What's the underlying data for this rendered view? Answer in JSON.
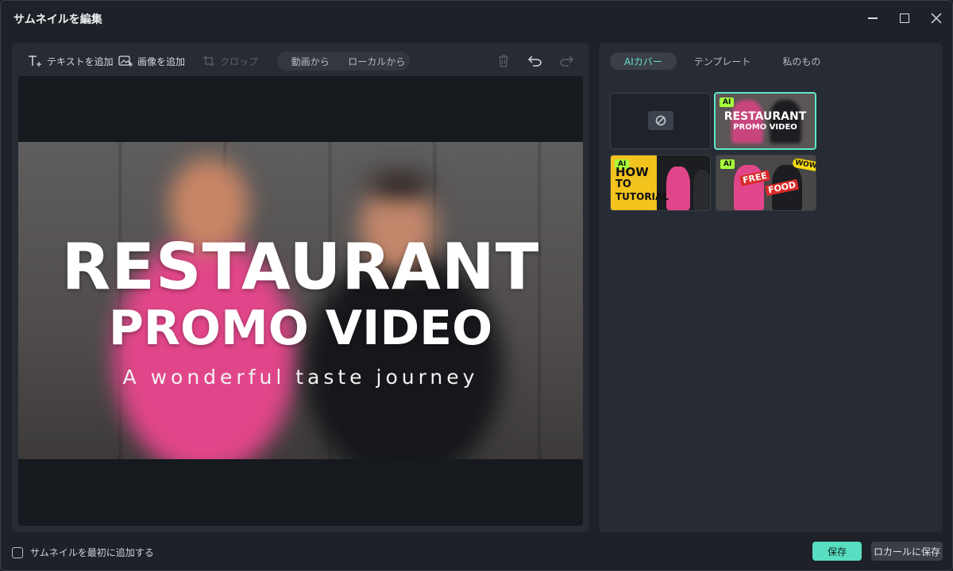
{
  "window": {
    "title": "サムネイルを編集",
    "controls": {
      "minimize": "minimize-icon",
      "maximize": "maximize-icon",
      "close": "close-icon"
    }
  },
  "toolbar": {
    "add_text": "テキストを追加",
    "add_image": "画像を追加",
    "crop": "クロップ",
    "source_segments": [
      "動画から",
      "ローカルから"
    ],
    "icons": [
      "delete-icon",
      "undo-icon",
      "redo-icon"
    ]
  },
  "preview": {
    "title_line1": "RESTAURANT",
    "title_line2": "PROMO VIDEO",
    "subtitle": "A wonderful taste journey"
  },
  "side": {
    "tabs": [
      {
        "label": "AIカバー",
        "active": true
      },
      {
        "label": "テンプレート",
        "active": false
      },
      {
        "label": "私のもの",
        "active": false
      }
    ],
    "thumbnails": [
      {
        "kind": "none",
        "icon": "none-icon"
      },
      {
        "kind": "ai",
        "tag": "AI",
        "line1": "RESTAURANT",
        "line2": "PROMO VIDEO",
        "selected": true
      },
      {
        "kind": "ai",
        "tag": "AI",
        "line1": "HOW",
        "line2": "TO",
        "line3": "TUTORIAL"
      },
      {
        "kind": "ai",
        "tag": "AI",
        "line1": "FREE",
        "line2": "FOOD",
        "badge": "WOW!"
      }
    ]
  },
  "footer": {
    "checkbox_label": "サムネイルを最初に追加する",
    "save": "保存",
    "save_local": "ロカールに保存"
  },
  "colors": {
    "accent": "#58dfc2",
    "ai_tag": "#a6ff3b"
  }
}
